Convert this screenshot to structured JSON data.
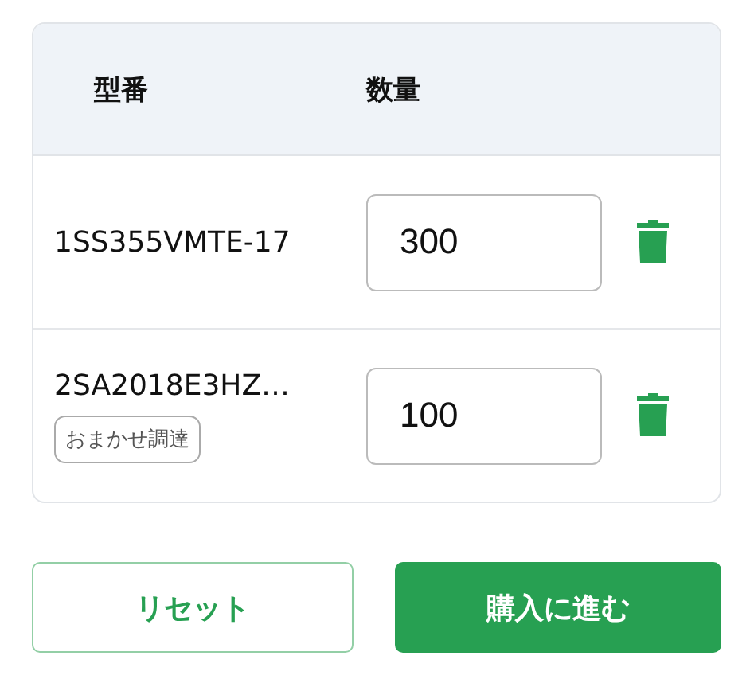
{
  "table": {
    "columns": [
      "型番",
      "数量"
    ],
    "rows": [
      {
        "part_number": "1SS355VMTE-17",
        "quantity": "300"
      },
      {
        "part_number": "2SA2018E3HZ…",
        "tag": "おまかせ調達",
        "quantity": "100"
      }
    ]
  },
  "buttons": {
    "reset": "リセット",
    "proceed": "購入に進む"
  }
}
